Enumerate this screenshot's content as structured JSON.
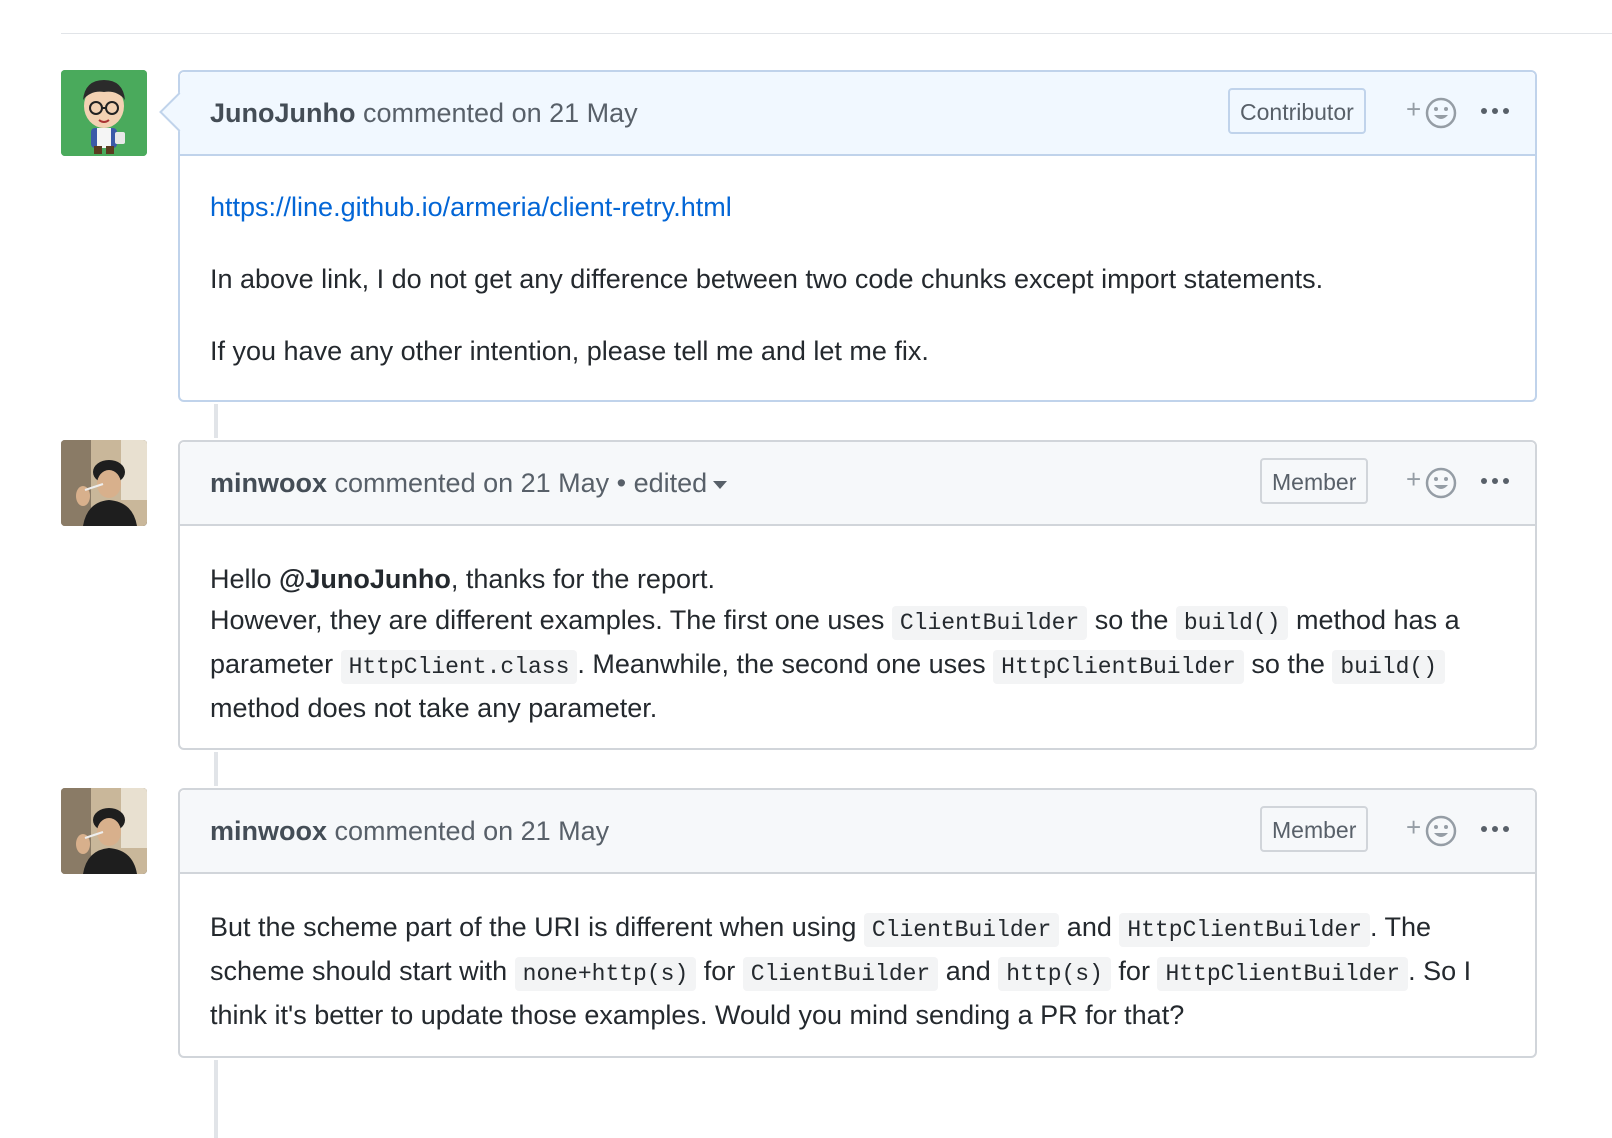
{
  "comments": [
    {
      "author": "JunoJunho",
      "action": " commented ",
      "date": "on 21 May",
      "role": "Contributor",
      "body": {
        "link": "https://line.github.io/armeria/client-retry.html",
        "p1": "In above link, I do not get any difference between two code chunks except import statements.",
        "p2": "If you have any other intention, please tell me and let me fix."
      }
    },
    {
      "author": "minwoox",
      "action": " commented ",
      "date": "on 21 May",
      "edited": " • edited",
      "role": "Member",
      "body": {
        "t1": "Hello ",
        "mention": "@JunoJunho",
        "t2": ", thanks for the report.",
        "t3": "However, they are different examples. The first one uses ",
        "c1": "ClientBuilder",
        "t4": " so the ",
        "c2": "build()",
        "t5": " method has a parameter ",
        "c3": "HttpClient.class",
        "t6": ". Meanwhile, the second one uses ",
        "c4": "HttpClientBuilder",
        "t7": " so the ",
        "c5": "build()",
        "t8": " method does not take any parameter."
      }
    },
    {
      "author": "minwoox",
      "action": " commented ",
      "date": "on 21 May",
      "role": "Member",
      "body": {
        "t1": "But the scheme part of the URI is different when using ",
        "c1": "ClientBuilder",
        "t2": " and ",
        "c2": "HttpClientBuilder",
        "t3": ". The scheme should start with ",
        "c3": "none+http(s)",
        "t4": " for ",
        "c4": "ClientBuilder",
        "t5": " and ",
        "c5": "http(s)",
        "t6": " for ",
        "c6": "HttpClientBuilder",
        "t7": ". So I think it's better to update those examples. Would you mind sending a PR for that?"
      }
    }
  ],
  "icons": {
    "reaction": "smiley-plus-icon",
    "more": "kebab-horizontal-icon",
    "caret": "caret-down-icon"
  },
  "colors": {
    "link": "#0366d6",
    "own_header": "#f1f8ff",
    "header": "#f6f8fa",
    "border": "#d1d5da"
  }
}
